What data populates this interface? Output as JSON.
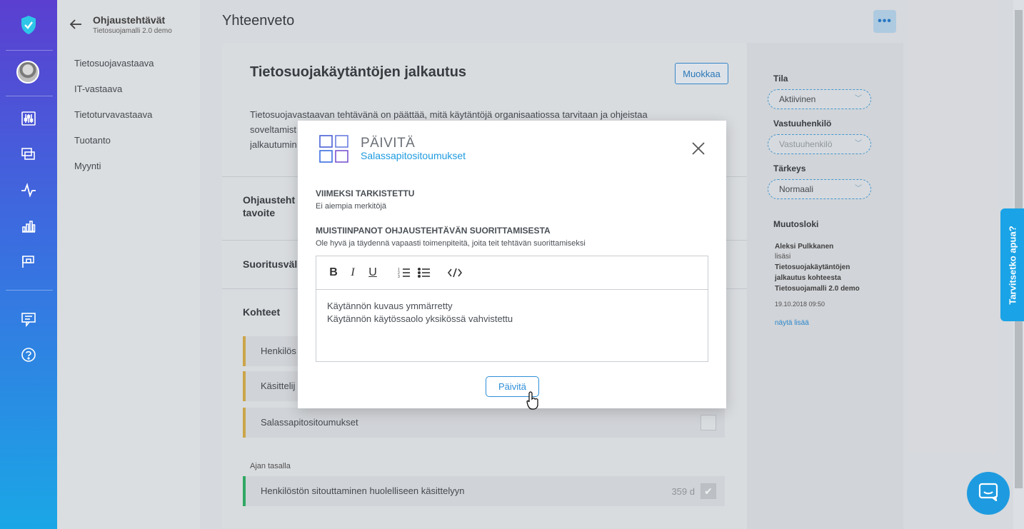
{
  "nav": {
    "back_title": "Ohjaustehtävät",
    "back_subtitle": "Tietosuojamalli 2.0 demo",
    "items": [
      "Tietosuojavastaava",
      "IT-vastaava",
      "Tietoturvavastaava",
      "Tuotanto",
      "Myynti"
    ]
  },
  "page": {
    "title": "Yhteenveto",
    "card_title": "Tietosuojakäytäntöjen jalkautus",
    "edit_label": "Muokkaa",
    "desc_line1": "Tietosuojavastaavan tehtävänä on päättää, mitä käytäntöjä organisaatiossa tarvitaan ja ohjeistaa",
    "desc_line2": "soveltamist",
    "desc_line3": "jalkautumin",
    "section_goal_1": "Ohjausteht",
    "section_goal_2": "tavoite",
    "section_interval": "Suoritusväli",
    "section_targets": "Kohteet",
    "targets": [
      "Henkilös",
      "Käsittelij",
      "Salassapitositoumukset"
    ],
    "uptodate_label": "Ajan tasalla",
    "uptodate_item": "Henkilöstön sitouttaminen huolelliseen käsittelyyn",
    "uptodate_days": "359 d"
  },
  "side": {
    "state_label": "Tila",
    "state_value": "Aktiivinen",
    "owner_label": "Vastuuhenkilö",
    "owner_placeholder": "Vastuuhenkilö",
    "priority_label": "Tärkeys",
    "priority_value": "Normaali",
    "log_label": "Muutosloki",
    "log_author": "Aleksi Pulkkanen",
    "log_action": "lisäsi",
    "log_line1": "Tietosuojakäytäntöjen",
    "log_line2": "jalkautus kohteesta",
    "log_line3": "Tietosuojamalli 2.0 demo",
    "log_time": "19.10.2018 09:50",
    "log_more": "näytä lisää"
  },
  "help_tab": "Tarvitsetko apua?",
  "modal": {
    "title": "PÄIVITÄ",
    "subtitle": "Salassapitositoumukset",
    "last_checked_heading": "VIIMEKSI TARKISTETTU",
    "last_checked_value": "Ei aiempia merkitöjä",
    "notes_heading": "MUISTIINPANOT OHJAUSTEHTÄVÄN SUORITTAMISESTA",
    "notes_hint": "Ole hyvä ja täydennä vapaasti toimenpiteitä, joita teit tehtävän suorittamiseksi",
    "notes_line1": "Käytännön kuvaus ymmärretty",
    "notes_line2": "Käytännön käytössaolo yksikössä vahvistettu",
    "update_label": "Päivitä"
  }
}
